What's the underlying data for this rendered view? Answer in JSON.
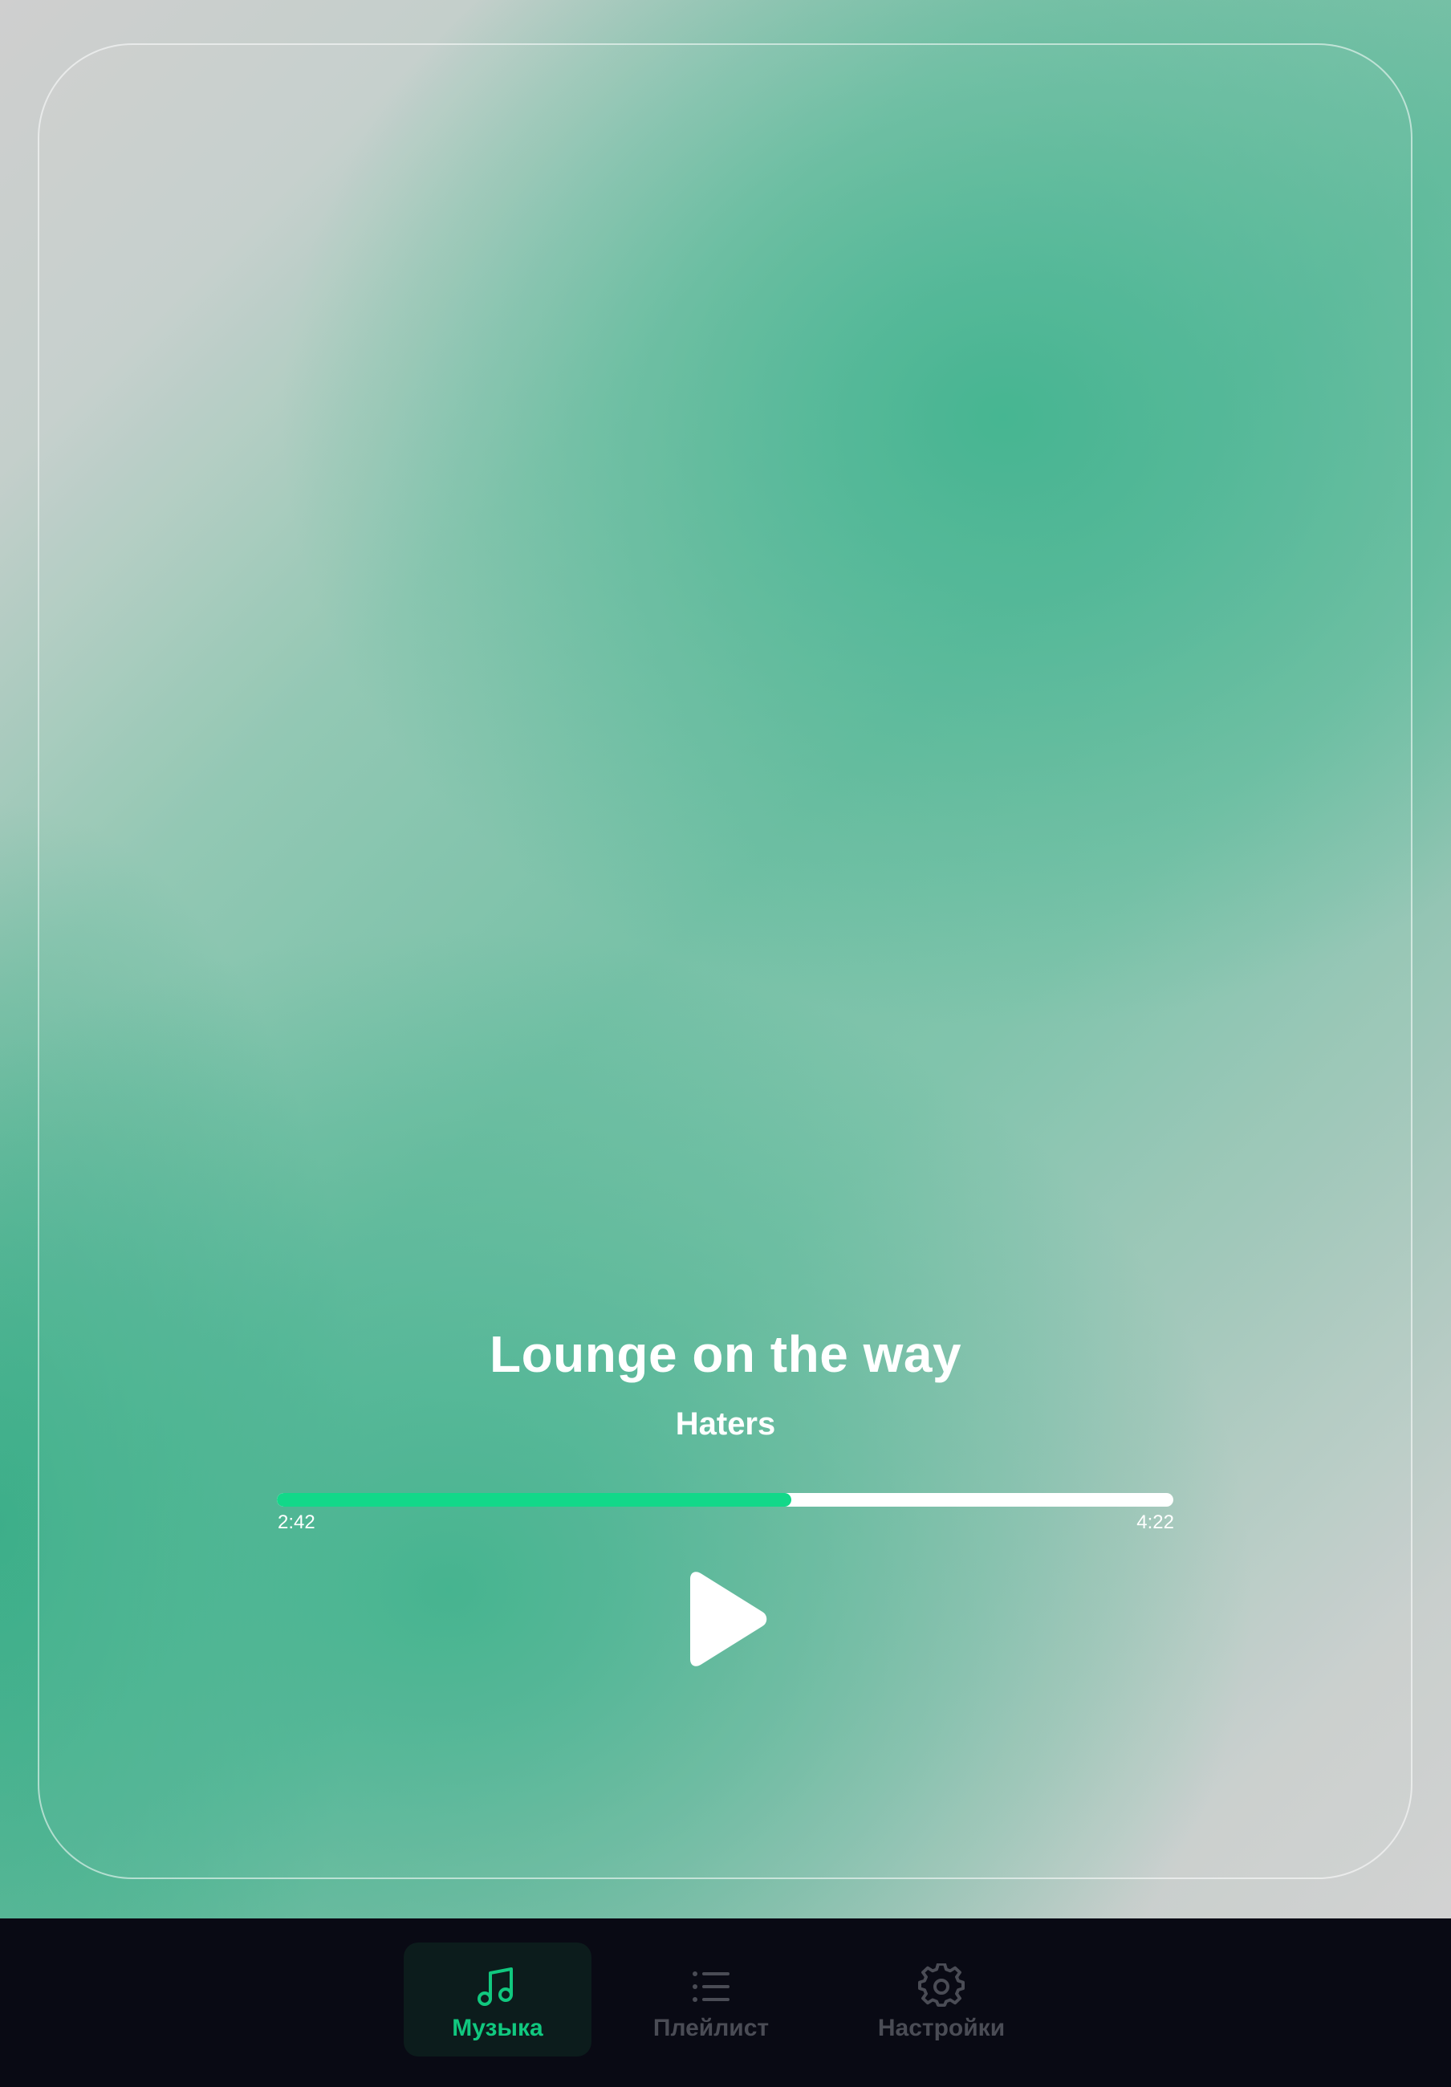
{
  "player": {
    "track_title": "Lounge on the way",
    "artist": "Haters",
    "current_time": "2:42",
    "total_time": "4:22",
    "progress_fraction": 0.574,
    "play_icon": "play-icon"
  },
  "nav": {
    "items": [
      {
        "label": "Музыка",
        "icon": "music-note-icon",
        "active": true
      },
      {
        "label": "Плейлист",
        "icon": "list-icon",
        "active": false
      },
      {
        "label": "Настройки",
        "icon": "gear-icon",
        "active": false
      }
    ]
  },
  "colors": {
    "accent": "#12d889",
    "nav_active_label": "#11c87f",
    "nav_background": "#090a14",
    "nav_inactive": "#4a4c55",
    "background_green": "#5cbb9c",
    "background_gray": "#cfcfcf"
  }
}
